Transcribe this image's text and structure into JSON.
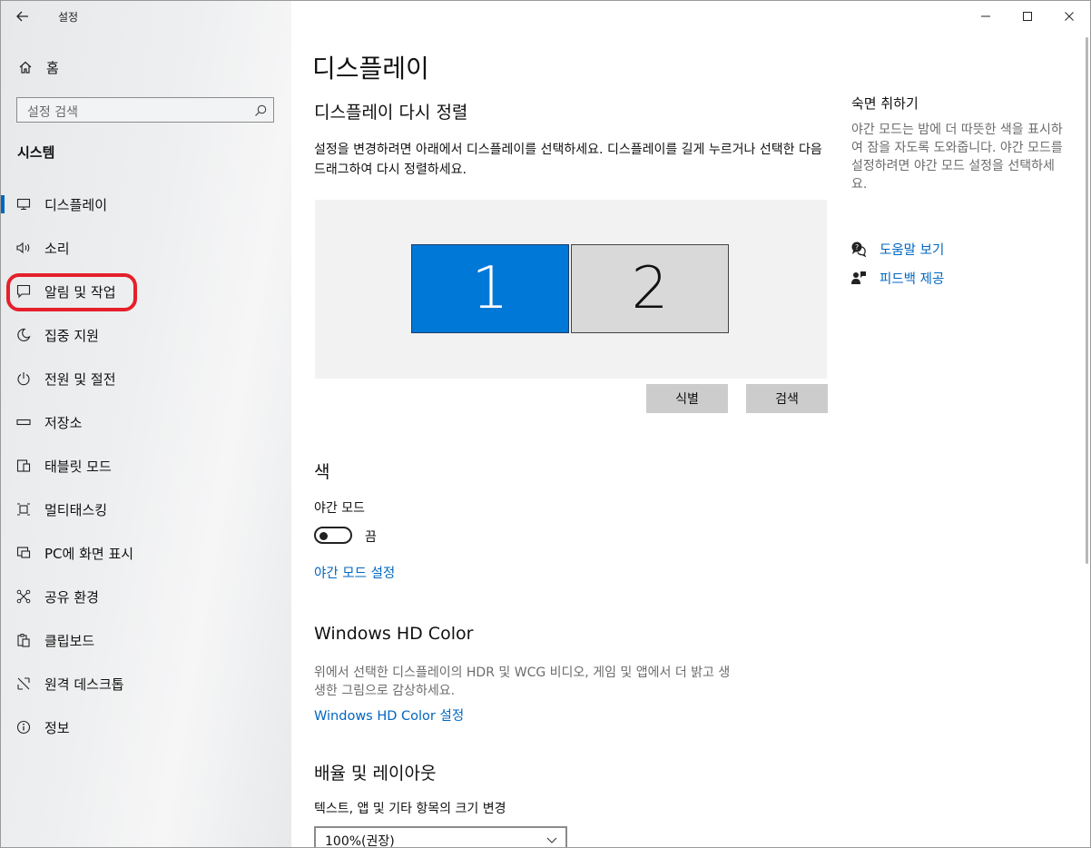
{
  "window": {
    "title": "설정"
  },
  "sidebar": {
    "home_label": "홈",
    "search_placeholder": "설정 검색",
    "section_title": "시스템",
    "items": [
      {
        "label": "디스플레이",
        "icon": "monitor-icon",
        "selected": true
      },
      {
        "label": "소리",
        "icon": "speaker-icon"
      },
      {
        "label": "알림 및 작업",
        "icon": "notification-icon",
        "highlighted": true
      },
      {
        "label": "집중 지원",
        "icon": "moon-icon"
      },
      {
        "label": "전원 및 절전",
        "icon": "power-icon"
      },
      {
        "label": "저장소",
        "icon": "storage-icon"
      },
      {
        "label": "태블릿 모드",
        "icon": "tablet-icon"
      },
      {
        "label": "멀티태스킹",
        "icon": "multitasking-icon"
      },
      {
        "label": "PC에 화면 표시",
        "icon": "project-icon"
      },
      {
        "label": "공유 환경",
        "icon": "share-icon"
      },
      {
        "label": "클립보드",
        "icon": "clipboard-icon"
      },
      {
        "label": "원격 데스크톱",
        "icon": "remote-desktop-icon"
      },
      {
        "label": "정보",
        "icon": "info-icon"
      }
    ]
  },
  "main": {
    "title": "디스플레이",
    "arrange": {
      "heading": "디스플레이 다시 정렬",
      "description": "설정을 변경하려면 아래에서 디스플레이를 선택하세요. 디스플레이를 길게 누르거나 선택한 다음 드래그하여 다시 정렬하세요.",
      "monitors": [
        "1",
        "2"
      ],
      "identify_label": "식별",
      "detect_label": "검색"
    },
    "color": {
      "heading": "색",
      "night_mode_label": "야간 모드",
      "toggle_state": "끔",
      "night_mode_settings_link": "야간 모드 설정"
    },
    "hdr": {
      "heading": "Windows HD Color",
      "description": "위에서 선택한 디스플레이의 HDR 및 WCG 비디오, 게임 및 앱에서 더 밝고 생생한 그림으로 감상하세요.",
      "link": "Windows HD Color 설정"
    },
    "scale": {
      "heading": "배율 및 레이아웃",
      "size_label": "텍스트, 앱 및 기타 항목의 크기 변경",
      "dropdown_value": "100%(권장)"
    }
  },
  "side_panel": {
    "title": "숙면 취하기",
    "description": "야간 모드는 밤에 더 따뜻한 색을 표시하여 잠을 자도록 도와줍니다. 야간 모드를 설정하려면 야간 모드 설정을 선택하세요.",
    "help_link": "도움말 보기",
    "feedback_link": "피드백 제공"
  },
  "colors": {
    "accent": "#0067c0",
    "monitor_selected": "#0078d7",
    "highlight": "#e5202a"
  }
}
